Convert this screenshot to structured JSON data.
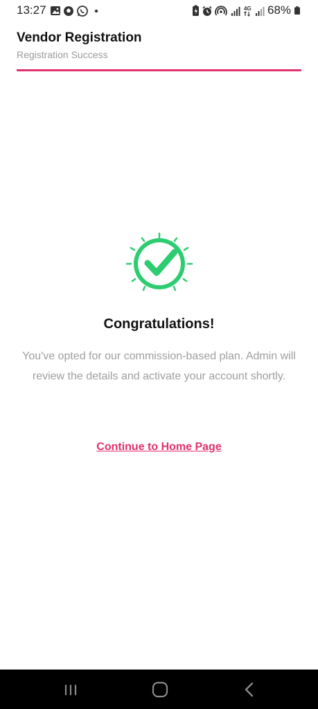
{
  "status_bar": {
    "time": "13:27",
    "battery": "68%",
    "left_icons": [
      "gallery-icon",
      "football-icon",
      "whatsapp-icon",
      "dot-icon"
    ],
    "right_icons": [
      "battery-saver-icon",
      "alarm-icon",
      "hotspot-icon",
      "signal-icon",
      "4g-icon",
      "signal-icon-2"
    ],
    "network_label": "4G"
  },
  "header": {
    "title": "Vendor Registration",
    "subtitle": "Registration Success",
    "accent_color": "#e1306c"
  },
  "content": {
    "icon": "check-circle-icon",
    "icon_color": "#2ecc71",
    "heading": "Congratulations!",
    "message": "You've opted for our commission-based plan. Admin will review the details and activate your account shortly.",
    "link_label": "Continue to Home Page"
  },
  "nav_bar": {
    "buttons": [
      "recent-apps-icon",
      "home-icon",
      "back-icon"
    ]
  }
}
